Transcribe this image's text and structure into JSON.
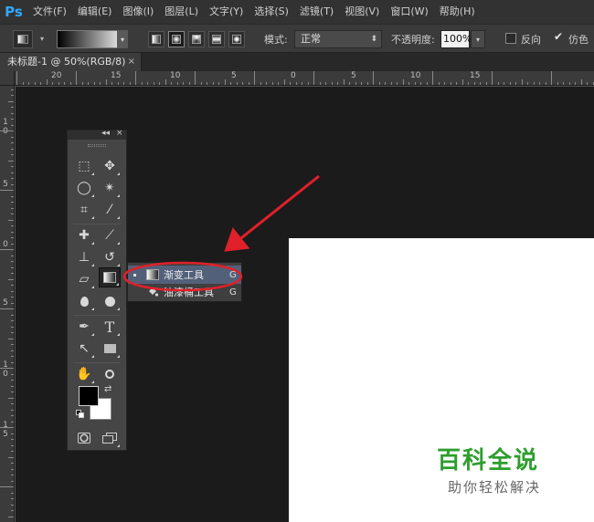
{
  "app": {
    "logo": "Ps",
    "menu": [
      "文件(F)",
      "编辑(E)",
      "图像(I)",
      "图层(L)",
      "文字(Y)",
      "选择(S)",
      "滤镜(T)",
      "视图(V)",
      "窗口(W)",
      "帮助(H)"
    ]
  },
  "options": {
    "mode_label": "模式:",
    "mode_value": "正常",
    "opacity_label": "不透明度:",
    "opacity_value": "100%",
    "reverse_label": "反向",
    "reverse_checked": false,
    "dither_label": "仿色",
    "dither_checked": true
  },
  "document": {
    "tab_title": "未标题-1 @ 50%(RGB/8)",
    "close_glyph": "×"
  },
  "rulers": {
    "top": [
      "20",
      "15",
      "10",
      "5",
      "0",
      "5",
      "10",
      "15"
    ],
    "left": [
      "1",
      "0",
      "5",
      "0",
      "5",
      "1",
      "0",
      "1",
      "5"
    ]
  },
  "toolbox": {
    "collapse_glyph": "◂◂",
    "close_glyph": "×",
    "tools": [
      {
        "name": "rectangular-marquee-icon",
        "glyph": "⬚"
      },
      {
        "name": "move-icon",
        "glyph": "✥"
      },
      {
        "name": "lasso-icon",
        "glyph": "◯"
      },
      {
        "name": "magic-wand-icon",
        "glyph": "✴"
      },
      {
        "name": "crop-icon",
        "glyph": "⌗"
      },
      {
        "name": "eyedropper-icon",
        "glyph": "⁄"
      },
      {
        "name": "healing-brush-icon",
        "glyph": "✚"
      },
      {
        "name": "brush-icon",
        "glyph": "⟋"
      },
      {
        "name": "clone-stamp-icon",
        "glyph": "⊥"
      },
      {
        "name": "history-brush-icon",
        "glyph": "↺"
      },
      {
        "name": "eraser-icon",
        "glyph": "▱"
      },
      {
        "name": "gradient-tool-icon",
        "glyph": ""
      },
      {
        "name": "blur-icon",
        "glyph": "💧"
      },
      {
        "name": "dodge-icon",
        "glyph": "🔍"
      },
      {
        "name": "pen-icon",
        "glyph": "✒"
      },
      {
        "name": "type-icon",
        "glyph": "T"
      },
      {
        "name": "path-selection-icon",
        "glyph": "↖"
      },
      {
        "name": "shape-icon",
        "glyph": "▭"
      },
      {
        "name": "hand-icon",
        "glyph": "✋"
      },
      {
        "name": "zoom-icon",
        "glyph": "🔍"
      }
    ]
  },
  "flyout": {
    "items": [
      {
        "label": "渐变工具",
        "key": "G",
        "selected": true
      },
      {
        "label": "油漆桶工具",
        "key": "G",
        "selected": false
      }
    ]
  },
  "annotation_colors": {
    "arrow": "#e0202a",
    "ellipse": "#e0202a"
  },
  "watermark": {
    "title": "百科全说",
    "subtitle": "助你轻松解决"
  }
}
